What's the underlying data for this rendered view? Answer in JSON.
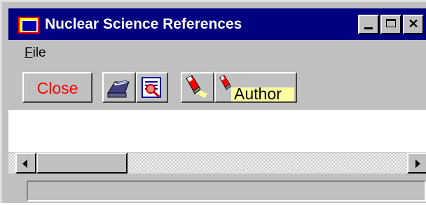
{
  "window": {
    "title": "Nuclear Science References"
  },
  "titlebar": {
    "app_icon": "app-icon",
    "buttons": {
      "minimize_icon": "minimize-icon",
      "maximize_icon": "maximize-icon",
      "close_glyph": "✕"
    }
  },
  "menu": {
    "file_mnemonic": "F",
    "file_rest": "ile"
  },
  "toolbar": {
    "close_label": "Close",
    "close_color": "#ff0000",
    "tray_icon": "inbox-tray-icon",
    "find_icon": "document-search-icon",
    "torch_icon": "flashlight-icon",
    "author_label": "Author",
    "author_icon": "flashlight-icon"
  },
  "status": {
    "text": ""
  },
  "colors": {
    "titlebar": "#000080",
    "face": "#c0c0c0",
    "content": "#ffffff",
    "author_highlight": "#ffffa0"
  }
}
